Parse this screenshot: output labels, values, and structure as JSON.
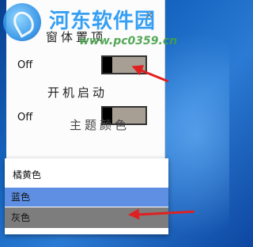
{
  "watermark": {
    "title": "河东软件园",
    "url": "www.pc0359.cn"
  },
  "settings": {
    "close_glyph": "✕",
    "always_on_top_label": "窗体置顶",
    "startup_label": "开机启动",
    "theme_label": "主题颜色",
    "always_on_top_state": "Off",
    "startup_state": "Off"
  },
  "theme_menu": {
    "options": [
      "橘黄色",
      "蓝色",
      "灰色"
    ],
    "hovered": "蓝色",
    "selected": "灰色"
  },
  "colors": {
    "toggle_track": "#a89f94",
    "toggle_knob": "#000000",
    "option_blue": "#5e8fe2",
    "option_gray": "#7d7d7d",
    "annotation_arrow": "#e02020"
  }
}
